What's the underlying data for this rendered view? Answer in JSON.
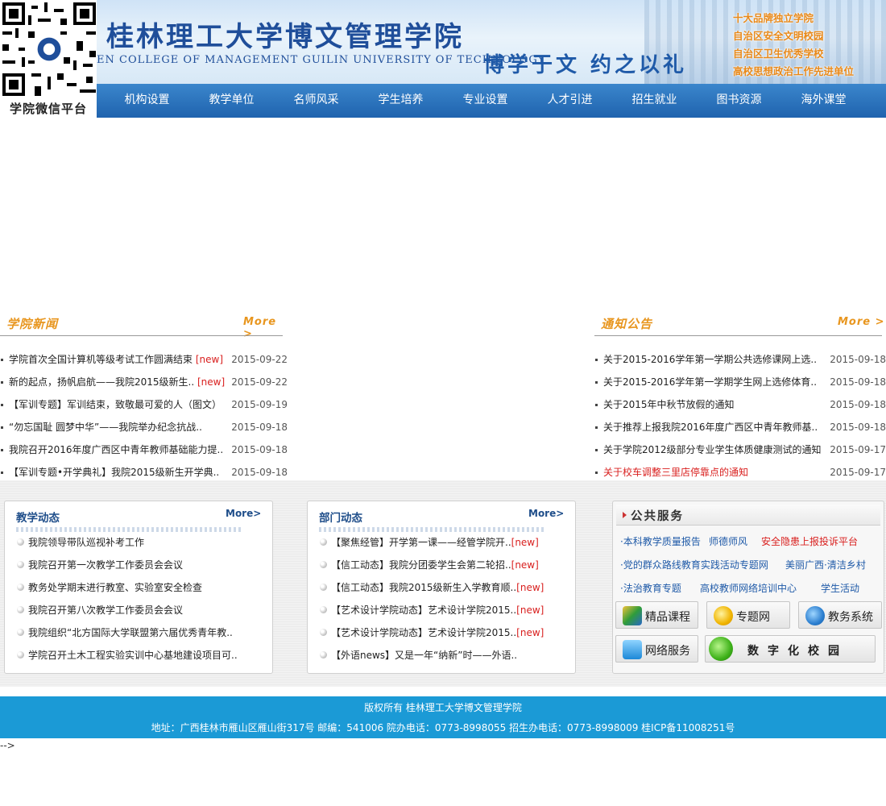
{
  "header": {
    "qr_label": "学院微信平台",
    "school_name": "桂林理工大学博文管理学院",
    "school_name_en": "EN COLLEGE OF MANAGEMENT GUILIN UNIVERSITY OF TECHNOLOGY",
    "motto": "博学于文 约之以礼",
    "honors": [
      "十大品牌独立学院",
      "自治区安全文明校园",
      "自治区卫生优秀学校",
      "高校思想政治工作先进单位"
    ]
  },
  "nav": [
    "机构设置",
    "教学单位",
    "名师风采",
    "学生培养",
    "专业设置",
    "人才引进",
    "招生就业",
    "图书资源",
    "海外课堂"
  ],
  "news": {
    "title": "学院新闻",
    "more": "More >",
    "new_tag": "[new]",
    "items": [
      {
        "text": "学院首次全国计算机等级考试工作圆满结束",
        "is_new": true,
        "date": "2015-09-22"
      },
      {
        "text": "新的起点，扬帆启航——我院2015级新生..",
        "is_new": true,
        "date": "2015-09-22"
      },
      {
        "text": "【军训专题】军训结束，致敬最可爱的人（图文）",
        "is_new": false,
        "date": "2015-09-19"
      },
      {
        "text": "“勿忘国耻 圆梦中华”——我院举办纪念抗战..",
        "is_new": false,
        "date": "2015-09-18"
      },
      {
        "text": "我院召开2016年度广西区中青年教师基础能力提..",
        "is_new": false,
        "date": "2015-09-18"
      },
      {
        "text": "【军训专题•开学典礼】我院2015级新生开学典..",
        "is_new": false,
        "date": "2015-09-18"
      }
    ]
  },
  "notices": {
    "title": "通知公告",
    "more": "More >",
    "items": [
      {
        "text": "关于2015-2016学年第一学期公共选修课网上选..",
        "date": "2015-09-18",
        "highlight": false
      },
      {
        "text": "关于2015-2016学年第一学期学生网上选修体育..",
        "date": "2015-09-18",
        "highlight": false
      },
      {
        "text": "关于2015年中秋节放假的通知",
        "date": "2015-09-18",
        "highlight": false
      },
      {
        "text": "关于推荐上报我院2016年度广西区中青年教师基..",
        "date": "2015-09-18",
        "highlight": false
      },
      {
        "text": "关于学院2012级部分专业学生体质健康测试的通知",
        "date": "2015-09-17",
        "highlight": false
      },
      {
        "text": "关于校车调整三里店停靠点的通知",
        "date": "2015-09-17",
        "highlight": true
      }
    ]
  },
  "teaching": {
    "title": "教学动态",
    "more": "More>",
    "items": [
      "我院领导带队巡视补考工作",
      "我院召开第一次教学工作委员会会议",
      "教务处学期末进行教室、实验室安全检查",
      "我院召开第八次教学工作委员会会议",
      "我院组织“北方国际大学联盟第六届优秀青年教..",
      "学院召开土木工程实验实训中心基地建设项目可.."
    ]
  },
  "dept": {
    "title": "部门动态",
    "more": "More>",
    "new_tag": "[new]",
    "items": [
      {
        "text": "【聚焦经管】开学第一课——经管学院开..",
        "is_new": true
      },
      {
        "text": "【信工动态】我院分团委学生会第二轮招..",
        "is_new": true
      },
      {
        "text": "【信工动态】我院2015级新生入学教育顺..",
        "is_new": true
      },
      {
        "text": "【艺术设计学院动态】艺术设计学院2015..",
        "is_new": true
      },
      {
        "text": "【艺术设计学院动态】艺术设计学院2015..",
        "is_new": true
      },
      {
        "text": "【外语news】又是一年“纳新”时——外语..",
        "is_new": false
      }
    ]
  },
  "services": {
    "title": "公共服务",
    "links": [
      {
        "text": "·本科教学质量报告",
        "red": false
      },
      {
        "text": "师德师风",
        "red": false
      },
      {
        "text": "安全隐患上报投诉平台",
        "red": true
      },
      {
        "text": "·党的群众路线教育实践活动专题网",
        "red": false
      },
      {
        "text": "美丽广西·清洁乡村",
        "red": false
      },
      {
        "text": "·法治教育专题",
        "red": false
      },
      {
        "text": "高校教师网络培训中心",
        "red": false
      },
      {
        "text": "学生活动",
        "red": false
      }
    ],
    "buttons": [
      "精品课程",
      "专题网",
      "教务系统",
      "网络服务",
      "数字化校园"
    ]
  },
  "footer": {
    "copyright": "版权所有  桂林理工大学博文管理学院",
    "info": "地址：广西桂林市雁山区雁山街317号    邮编：541006    院办电话：0773-8998055    招生办电话：0773-8998009    桂ICP备11008251号"
  },
  "stray_text": "-->",
  "colors": {
    "nav_blue": "#1f63ae",
    "accent_orange": "#e8961f",
    "new_red": "#d9201f",
    "footer_blue": "#1b9ad6"
  }
}
